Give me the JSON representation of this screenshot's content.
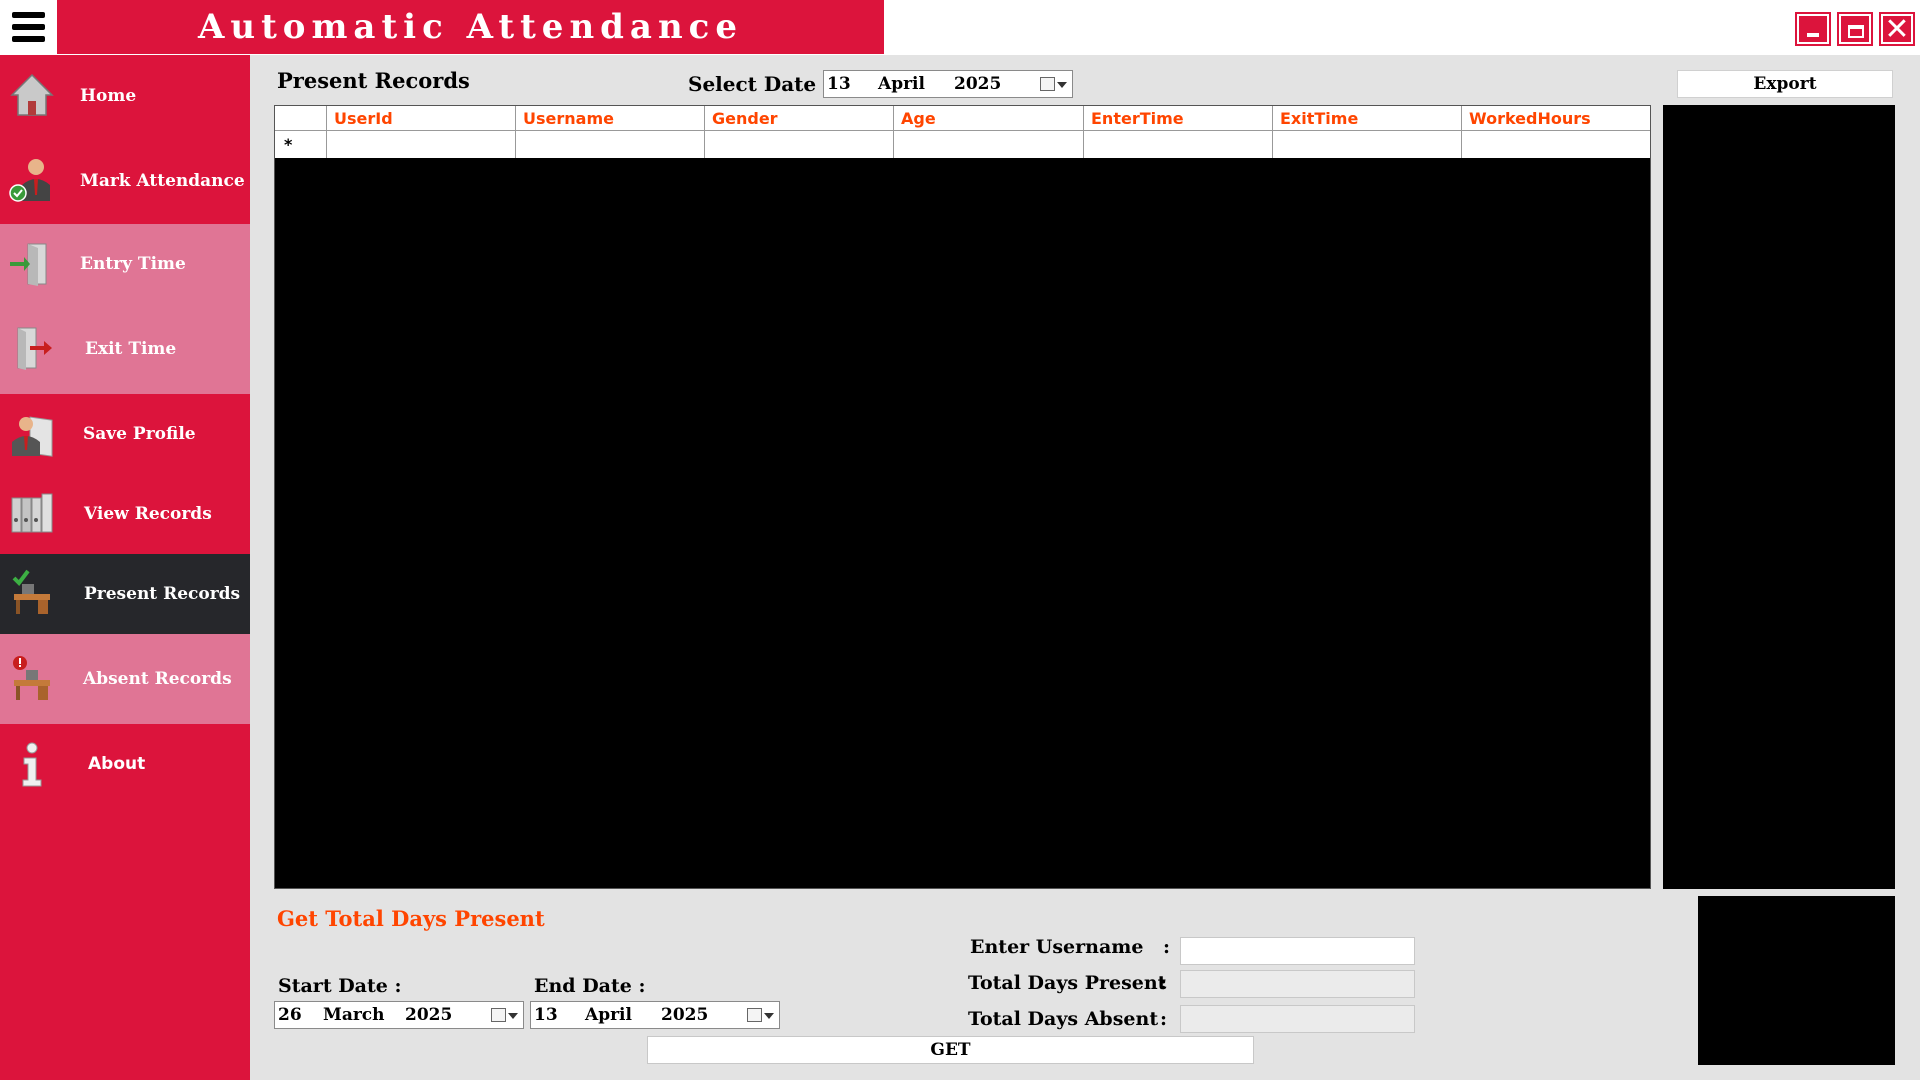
{
  "window": {
    "title": "Automatic Attendance"
  },
  "sidebar": {
    "items": [
      {
        "label": "Home",
        "icon": "home-icon"
      },
      {
        "label": "Mark Attendance",
        "icon": "user-check-icon"
      },
      {
        "label": "Entry Time",
        "icon": "door-enter-icon"
      },
      {
        "label": "Exit Time",
        "icon": "door-exit-icon"
      },
      {
        "label": "Save Profile",
        "icon": "profile-icon"
      },
      {
        "label": "View Records",
        "icon": "binders-icon"
      },
      {
        "label": "Present Records",
        "icon": "desk-check-icon"
      },
      {
        "label": "Absent Records",
        "icon": "desk-alert-icon"
      },
      {
        "label": "About",
        "icon": "info-icon"
      }
    ],
    "active": "Present Records"
  },
  "main": {
    "heading": "Present Records",
    "select_date_label": "Select Date :",
    "select_date": {
      "day": "13",
      "month": "April",
      "year": "2025"
    },
    "export_label": "Export",
    "grid": {
      "columns": [
        "UserId",
        "Username",
        "Gender",
        "Age",
        "EnterTime",
        "ExitTime",
        "WorkedHours"
      ],
      "new_row_marker": "*",
      "rows": []
    }
  },
  "totals": {
    "title": "Get Total Days Present",
    "start_date_label": "Start Date :",
    "start_date": {
      "day": "26",
      "month": "March",
      "year": "2025"
    },
    "end_date_label": "End Date :",
    "end_date": {
      "day": "13",
      "month": "April",
      "year": "2025"
    },
    "username_label": "Enter Username",
    "present_label": "Total Days Present",
    "absent_label": "Total Days Absent",
    "colon": ":",
    "username_value": "",
    "present_value": "",
    "absent_value": "",
    "get_label": "GET"
  },
  "colors": {
    "accent": "#dc143c",
    "accent_light": "#e07595",
    "active": "#26272b",
    "header_text": "#ff4500"
  }
}
